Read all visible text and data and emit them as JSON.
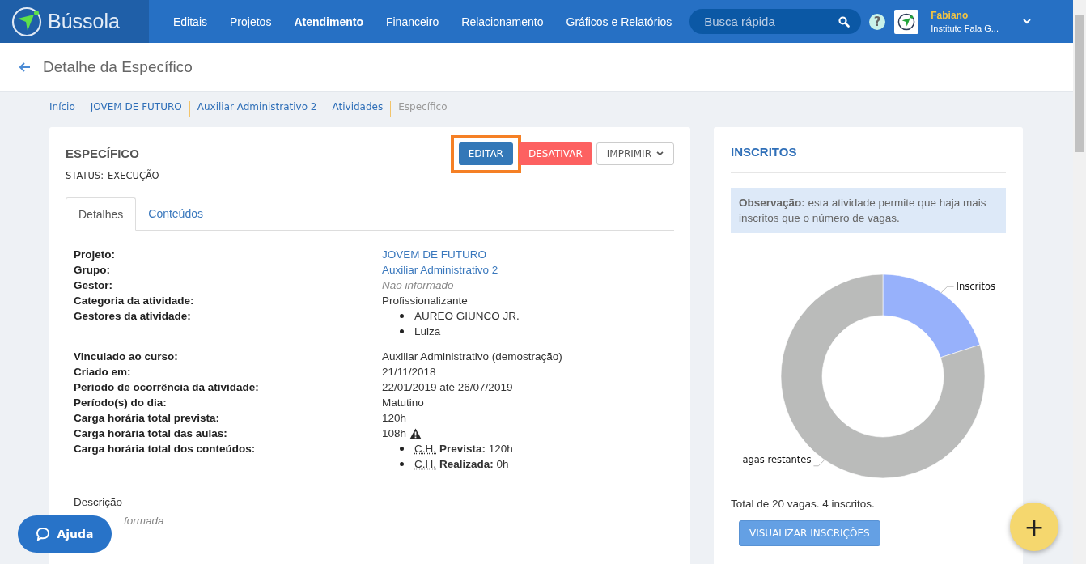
{
  "nav": {
    "logo": "Bússola",
    "items": [
      {
        "label": "Editais",
        "selected": false
      },
      {
        "label": "Projetos",
        "selected": false
      },
      {
        "label": "Atendimento",
        "selected": true
      },
      {
        "label": "Financeiro",
        "selected": false
      },
      {
        "label": "Relacionamento",
        "selected": false
      },
      {
        "label": "Gráficos e Relatórios",
        "selected": false
      }
    ],
    "search": {
      "placeholder": "Busca rápida"
    },
    "help": "?",
    "user": {
      "name": "Fabiano",
      "org": "Instituto Fala G..."
    }
  },
  "header": {
    "title": "Detalhe da Específico"
  },
  "breadcrumb": [
    {
      "label": "Início",
      "current": false
    },
    {
      "label": "JOVEM DE FUTURO",
      "current": false
    },
    {
      "label": "Auxiliar Administrativo 2",
      "current": false
    },
    {
      "label": "Atividades",
      "current": false
    },
    {
      "label": "Específico",
      "current": true
    }
  ],
  "activity": {
    "title": "ESPECÍFICO",
    "status_label": "STATUS:",
    "status": "EXECUÇÃO",
    "buttons": [
      {
        "label": "EDITAR",
        "kind": "primary",
        "highlighted": true
      },
      {
        "label": "DESATIVAR",
        "kind": "danger",
        "highlighted": false
      },
      {
        "label": "IMPRIMIR",
        "kind": "dropdown",
        "highlighted": false
      }
    ],
    "tabs": [
      {
        "label": "Detalhes",
        "selected": true
      },
      {
        "label": "Conteúdos",
        "selected": false
      }
    ],
    "detail_groups": [
      [
        {
          "label": "Projeto:",
          "kind": "link",
          "value": "JOVEM DE FUTURO"
        },
        {
          "label": "Grupo:",
          "kind": "link",
          "value": "Auxiliar Administrativo 2"
        },
        {
          "label": "Gestor:",
          "kind": "empty",
          "value": "Não informado"
        },
        {
          "label": "Categoria da atividade:",
          "kind": "text",
          "value": "Profissionalizante"
        },
        {
          "label": "Gestores da atividade:",
          "kind": "list",
          "items": [
            "AUREO GIUNCO JR.",
            "Luiza"
          ]
        }
      ],
      [
        {
          "label": "Vinculado ao curso:",
          "kind": "text",
          "value": "Auxiliar Administrativo (demostração)"
        },
        {
          "label": "Criado em:",
          "kind": "text",
          "value": "21/11/2018"
        },
        {
          "label": "Período de ocorrência da atividade:",
          "kind": "text",
          "value": "22/01/2019 até 26/07/2019"
        },
        {
          "label": "Período(s) do dia:",
          "kind": "text",
          "value": "Matutino"
        },
        {
          "label": "Carga horária total prevista:",
          "kind": "text",
          "value": "120h"
        },
        {
          "label": "Carga horária total das aulas:",
          "kind": "warning",
          "value": "108h"
        },
        {
          "label": "Carga horária total dos conteúdos:",
          "kind": "abbr_list",
          "items": [
            {
              "abbr": "C.H.",
              "text": "**Prevista:** 120h"
            },
            {
              "abbr": "C.H.",
              "text": "**Realizada:** 0h"
            }
          ]
        }
      ]
    ],
    "description": {
      "label": "Descrição",
      "value": "formada"
    }
  },
  "enrolled": {
    "title": "INSCRITOS",
    "note": "**Observação:** esta atividade permite que haja mais inscritos que o número de vagas.",
    "chart_data": {
      "type": "donut",
      "categories": [
        "Inscritos",
        "agas restantes"
      ],
      "values": [
        20,
        80
      ]
    },
    "total": "Total de 20 vagas. 4 inscritos.",
    "button": "VISUALIZAR INSCRIÇÕES"
  },
  "help_button": "Ajuda",
  "fab": "+"
}
